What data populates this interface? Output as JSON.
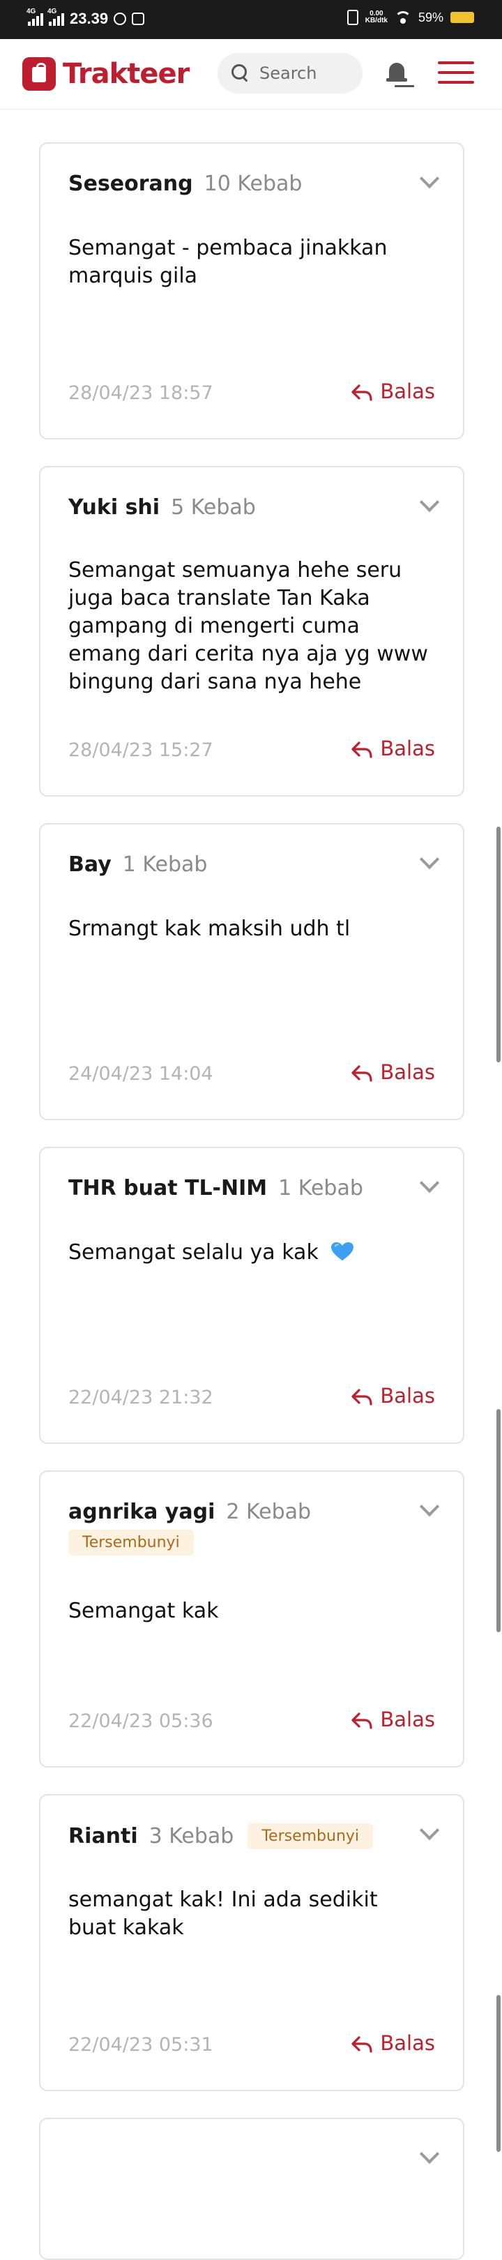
{
  "status_bar": {
    "network1": "4G",
    "network2": "4G",
    "time": "23.39",
    "data_speed_value": "0.00",
    "data_speed_unit": "KB/dtk",
    "battery": "59%"
  },
  "header": {
    "logo_text": "Trakteer",
    "search_placeholder": "Search"
  },
  "comments": [
    {
      "name": "Seseorang",
      "kebab": "10 Kebab",
      "badge": "",
      "message": "Semangat - pembaca jinakkan marquis gila",
      "time": "28/04/23 18:57",
      "reply": "Balas"
    },
    {
      "name": "Yuki shi",
      "kebab": "5 Kebab",
      "badge": "",
      "message": "Semangat semuanya hehe seru juga baca translate Tan Kaka gampang di mengerti cuma emang dari cerita nya aja yg www bingung dari sana nya hehe",
      "time": "28/04/23 15:27",
      "reply": "Balas"
    },
    {
      "name": "Bay",
      "kebab": "1 Kebab",
      "badge": "",
      "message": "Srmangt kak maksih udh tl",
      "time": "24/04/23 14:04",
      "reply": "Balas"
    },
    {
      "name": "THR buat TL-NIM",
      "kebab": "1 Kebab",
      "badge": "",
      "message": "Semangat selalu ya kak",
      "time": "22/04/23 21:32",
      "reply": "Balas"
    },
    {
      "name": "agnrika yagi",
      "kebab": "2 Kebab",
      "badge": "Tersembunyi",
      "message": "Semangat kak",
      "time": "22/04/23 05:36",
      "reply": "Balas"
    },
    {
      "name": "Rianti",
      "kebab": "3 Kebab",
      "badge": "Tersembunyi",
      "message": "semangat kak! Ini ada sedikit buat kakak",
      "time": "22/04/23 05:31",
      "reply": "Balas"
    }
  ],
  "colors": {
    "brand": "#be1e2d",
    "badge_bg": "#fdf2df",
    "badge_text": "#a86a1f",
    "card_border": "#e3e3e3"
  },
  "icons": {
    "logo": "trakteer-logo-icon",
    "search": "search-icon",
    "notifications": "bell-icon",
    "menu": "hamburger-menu-icon",
    "expand": "chevron-down-icon",
    "reply": "reply-arrow-icon",
    "emoji": "blue-heart-icon"
  }
}
